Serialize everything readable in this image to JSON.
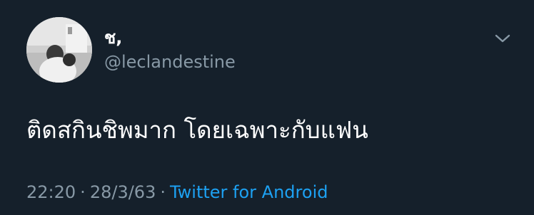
{
  "tweet": {
    "display_name": "ช,",
    "handle": "@leclandestine",
    "text": "ติดสกินชิพมาก โดยเฉพาะกับแฟน",
    "time": "22:20",
    "separator": "·",
    "date": "28/3/63",
    "source": "Twitter for Android"
  },
  "icons": {
    "more": "chevron-down-icon"
  },
  "colors": {
    "background": "#15202b",
    "primary_text": "#ffffff",
    "secondary_text": "#8899a6",
    "link": "#1da1f2"
  }
}
